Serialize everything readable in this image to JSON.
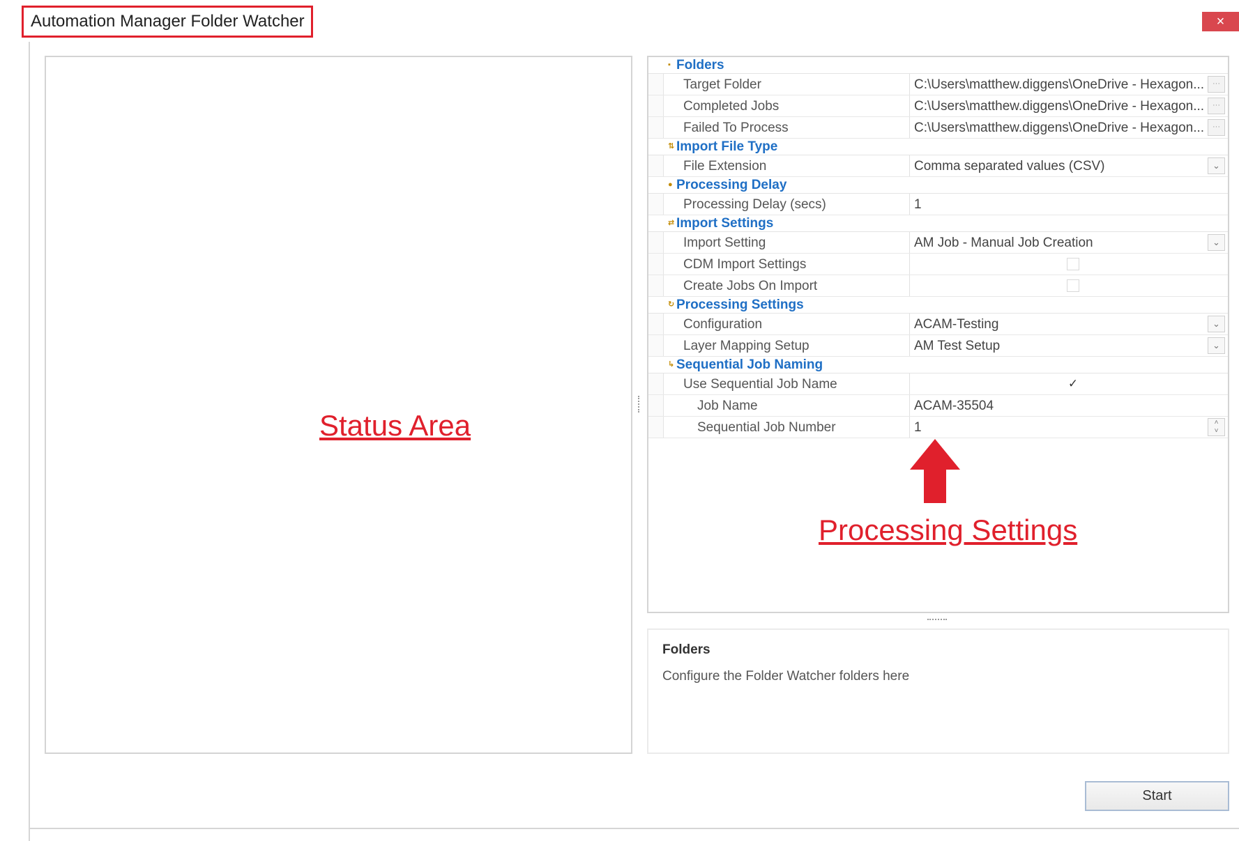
{
  "window": {
    "title": "Automation Manager Folder Watcher",
    "close_label": "×"
  },
  "status_area": {
    "label": "Status Area"
  },
  "property_grid": {
    "categories": [
      {
        "name": "Folders",
        "rows": [
          {
            "name": "Target Folder",
            "value": "C:\\Users\\matthew.diggens\\OneDrive - Hexagon...",
            "editor": "ellipsis"
          },
          {
            "name": "Completed Jobs",
            "value": "C:\\Users\\matthew.diggens\\OneDrive - Hexagon...",
            "editor": "ellipsis"
          },
          {
            "name": "Failed To Process",
            "value": "C:\\Users\\matthew.diggens\\OneDrive - Hexagon...",
            "editor": "ellipsis"
          }
        ]
      },
      {
        "name": "Import File Type",
        "rows": [
          {
            "name": "File Extension",
            "value": "Comma separated values (CSV)",
            "editor": "dropdown"
          }
        ]
      },
      {
        "name": "Processing Delay",
        "rows": [
          {
            "name": "Processing Delay (secs)",
            "value": "1",
            "editor": "text"
          }
        ]
      },
      {
        "name": "Import Settings",
        "rows": [
          {
            "name": "Import Setting",
            "value": "AM Job - Manual Job Creation",
            "editor": "dropdown"
          },
          {
            "name": "CDM Import Settings",
            "checked": false,
            "editor": "checkbox"
          },
          {
            "name": "Create Jobs On Import",
            "checked": false,
            "editor": "checkbox"
          }
        ]
      },
      {
        "name": "Processing Settings",
        "rows": [
          {
            "name": "Configuration",
            "value": "ACAM-Testing",
            "editor": "dropdown"
          },
          {
            "name": "Layer Mapping Setup",
            "value": "AM Test Setup",
            "editor": "dropdown"
          }
        ]
      },
      {
        "name": "Sequential Job Naming",
        "rows": [
          {
            "name": "Use Sequential Job Name",
            "checked": true,
            "editor": "checkbox"
          },
          {
            "name": "Job Name",
            "value": "ACAM-35504",
            "editor": "text",
            "indent": true
          },
          {
            "name": "Sequential Job Number",
            "value": "1",
            "editor": "spin",
            "indent": true
          }
        ]
      }
    ]
  },
  "annotation": {
    "label": "Processing Settings",
    "arrow_color": "#e0202c"
  },
  "description": {
    "title": "Folders",
    "text": "Configure the Folder Watcher folders here"
  },
  "actions": {
    "start_label": "Start"
  },
  "colors": {
    "highlight_red": "#e0202c",
    "category_blue": "#1f6fc5",
    "close_red": "#d9474e"
  }
}
